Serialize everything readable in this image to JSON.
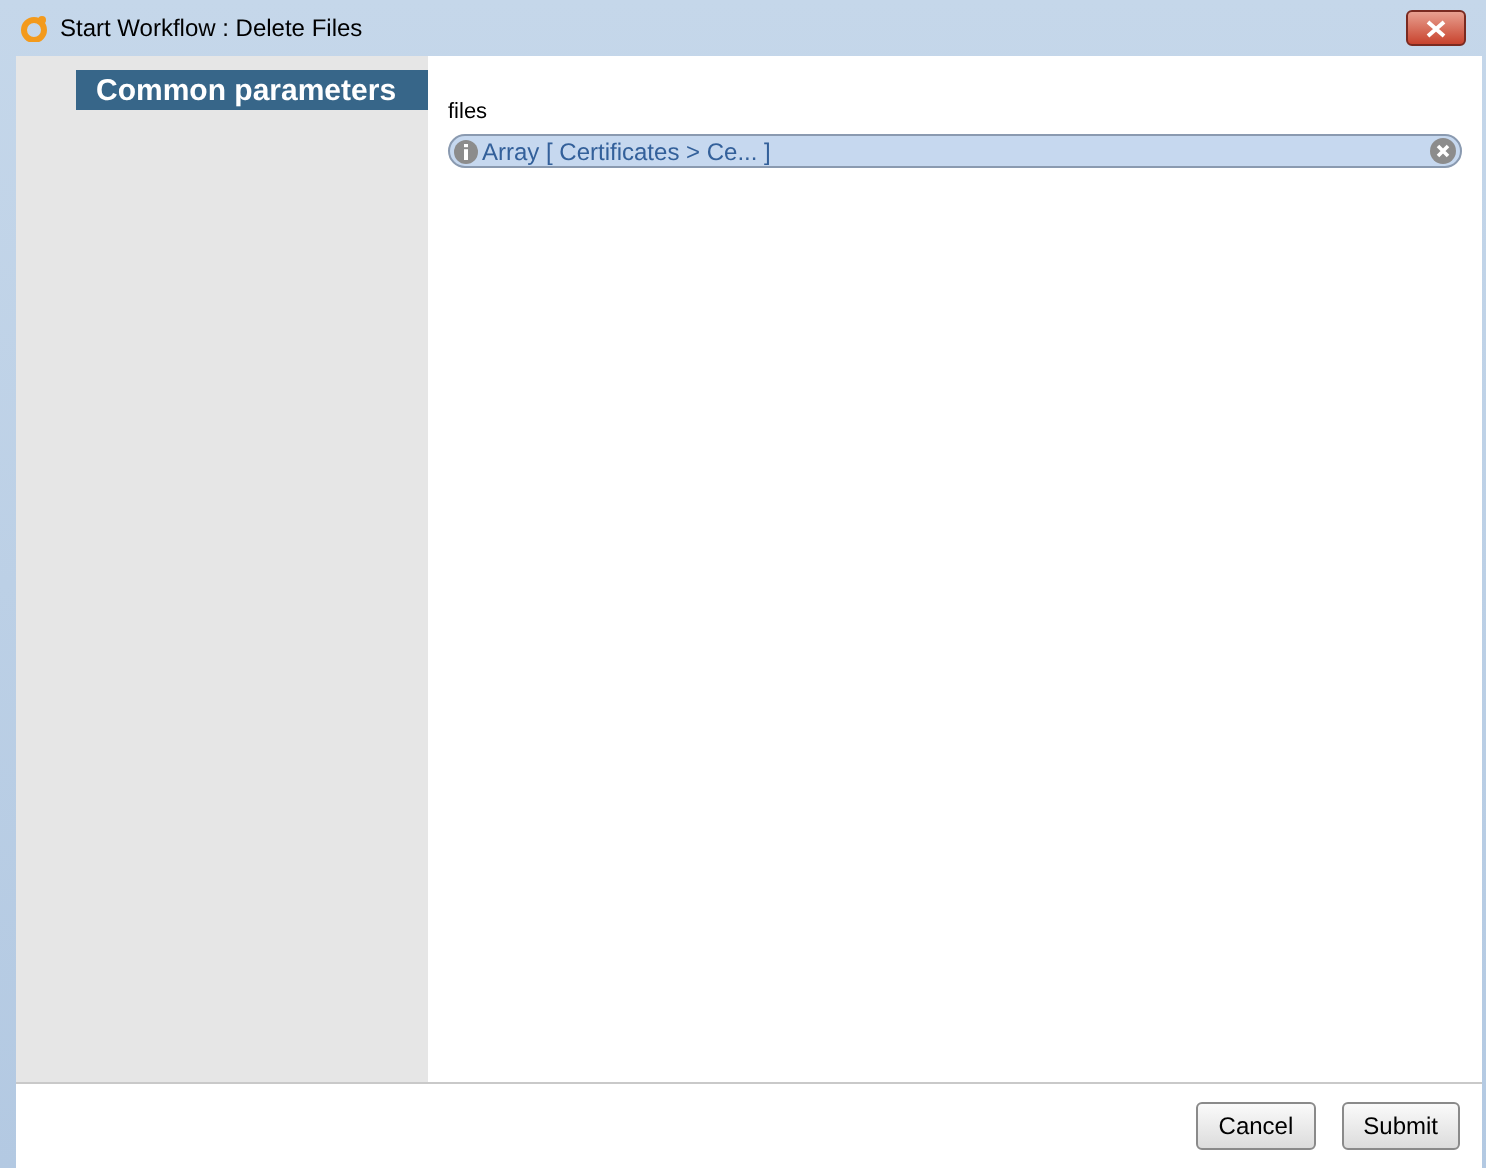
{
  "window": {
    "title": "Start Workflow : Delete Files"
  },
  "sidebar": {
    "items": [
      {
        "label": "Common parameters",
        "selected": true
      }
    ]
  },
  "fields": [
    {
      "label": "files",
      "value": "Array [ Certificates > Ce... ]"
    }
  ],
  "buttons": [
    "Cancel",
    "Submit"
  ]
}
